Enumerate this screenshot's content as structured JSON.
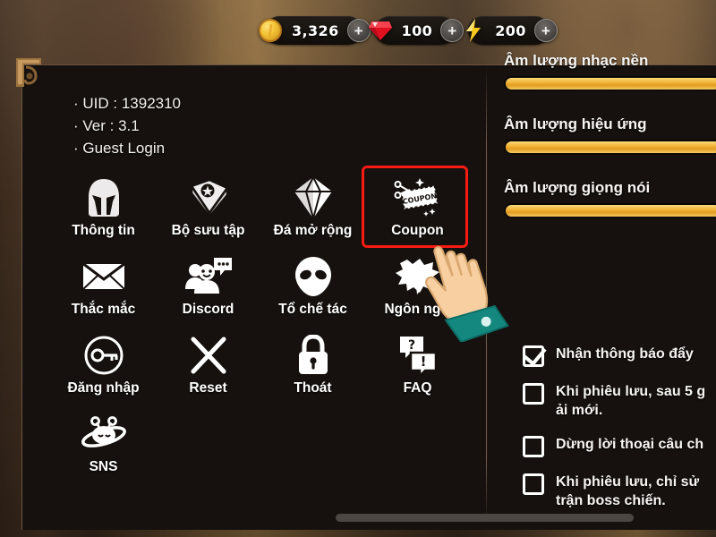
{
  "currency": [
    {
      "icon": "coin-icon",
      "name": "gold",
      "value": "3,326",
      "add_label": "+"
    },
    {
      "icon": "gem-icon",
      "name": "gem",
      "value": "100",
      "add_label": "+"
    },
    {
      "icon": "energy-bolt-icon",
      "name": "energy",
      "value": "200",
      "add_label": "+"
    }
  ],
  "account_info": {
    "uid": "· UID : 1392310",
    "version": "· Ver : 3.1",
    "login": "· Guest Login"
  },
  "menu": [
    {
      "label": "Thông tin",
      "icon": "helmet-icon",
      "selected": false
    },
    {
      "label": "Bộ sưu tập",
      "icon": "book-icon",
      "selected": false
    },
    {
      "label": "Đá mở rộng",
      "icon": "diamond-icon",
      "selected": false
    },
    {
      "label": "Coupon",
      "icon": "coupon-ticket-icon",
      "selected": true
    },
    {
      "label": "Thắc mắc",
      "icon": "envelope-icon",
      "selected": false
    },
    {
      "label": "Discord",
      "icon": "discord-users-icon",
      "selected": false
    },
    {
      "label": "Tổ chế tác",
      "icon": "alien-head-icon",
      "selected": false
    },
    {
      "label": "Ngôn ngữ",
      "icon": "speech-burst-icon",
      "selected": false
    },
    {
      "label": "Đăng nhập",
      "icon": "key-circle-icon",
      "selected": false
    },
    {
      "label": "Reset",
      "icon": "x-cross-icon",
      "selected": false
    },
    {
      "label": "Thoát",
      "icon": "lock-icon",
      "selected": false
    },
    {
      "label": "FAQ",
      "icon": "faq-bubbles-icon",
      "selected": false
    },
    {
      "label": "SNS",
      "icon": "saturn-alien-icon",
      "selected": false
    }
  ],
  "sliders": [
    {
      "label": "Âm lượng nhạc nền",
      "percent": 100
    },
    {
      "label": "Âm lượng hiệu ứng",
      "percent": 100
    },
    {
      "label": "Âm lượng giọng nói",
      "percent": 100
    }
  ],
  "checkboxes": [
    {
      "label": "Nhận thông báo đẩy",
      "checked": true
    },
    {
      "label": "Khi phiêu lưu, sau 5 g\nải mới.",
      "checked": false
    },
    {
      "label": "Dừng lời thoại câu ch",
      "checked": false
    },
    {
      "label": "Khi phiêu lưu, chỉ sử\ntrận boss chiến.",
      "checked": false
    }
  ],
  "colors": {
    "highlight_red": "#f71b13",
    "slider_gold": "#f2b437",
    "panel_bg": "#16110e",
    "text": "#f7f5f2",
    "hand_skin": "#f7cfa0",
    "hand_sleeve": "#14887f"
  },
  "cursor": {
    "icon": "pointing-hand-cursor"
  },
  "scrollbar": {
    "orientation": "horizontal"
  }
}
